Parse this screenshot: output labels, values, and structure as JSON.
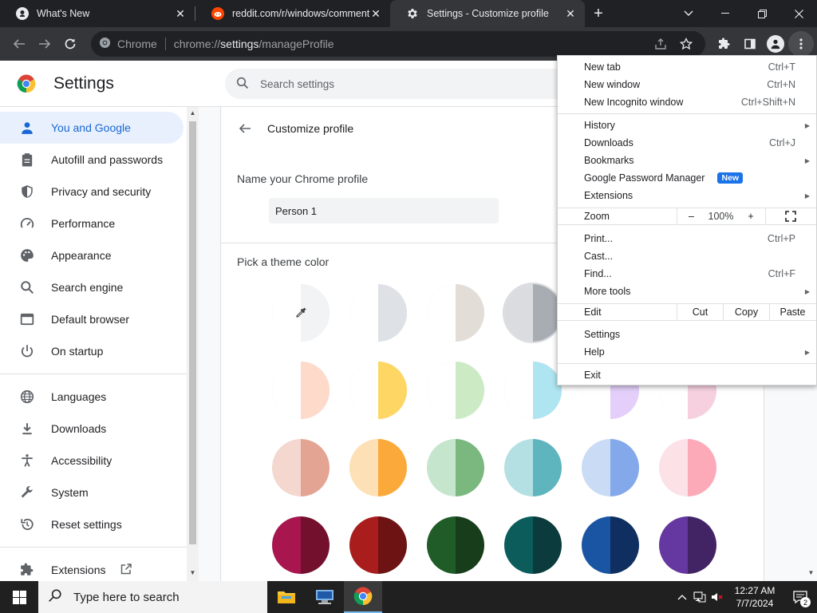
{
  "tabs": [
    {
      "title": "What's New",
      "icon": "github-icon"
    },
    {
      "title": "reddit.com/r/windows/comments",
      "icon": "reddit-icon"
    },
    {
      "title": "Settings - Customize profile",
      "icon": "gear-icon"
    }
  ],
  "omnibox": {
    "site": "Chrome",
    "url_scheme": "chrome://",
    "url_host": "settings",
    "url_path": "/manageProfile"
  },
  "settings": {
    "title": "Settings",
    "search_placeholder": "Search settings",
    "nav": [
      {
        "label": "You and Google",
        "icon": "person-icon"
      },
      {
        "label": "Autofill and passwords",
        "icon": "clipboard-icon"
      },
      {
        "label": "Privacy and security",
        "icon": "shield-icon"
      },
      {
        "label": "Performance",
        "icon": "gauge-icon"
      },
      {
        "label": "Appearance",
        "icon": "palette-icon"
      },
      {
        "label": "Search engine",
        "icon": "search-icon"
      },
      {
        "label": "Default browser",
        "icon": "browser-icon"
      },
      {
        "label": "On startup",
        "icon": "power-icon"
      },
      {
        "label": "Languages",
        "icon": "globe-icon"
      },
      {
        "label": "Downloads",
        "icon": "download-icon"
      },
      {
        "label": "Accessibility",
        "icon": "accessibility-icon"
      },
      {
        "label": "System",
        "icon": "wrench-icon"
      },
      {
        "label": "Reset settings",
        "icon": "reset-icon"
      },
      {
        "label": "Extensions",
        "icon": "puzzle-icon"
      }
    ]
  },
  "profile": {
    "heading": "Customize profile",
    "name_label": "Name your Chrome profile",
    "name_value": "Person 1",
    "theme_label": "Pick a theme color",
    "colors": {
      "row1": [
        [
          "#f1f3f4",
          "#f1f3f4"
        ],
        [
          "#ffffff",
          "#dee1e6"
        ],
        [
          "#ffffff",
          "#e3ddd8"
        ],
        [
          "#dadce0",
          "#a8adb3"
        ]
      ],
      "row2": [
        [
          "#ffffff",
          "#fddac9"
        ],
        [
          "#ffffff",
          "#fdd663"
        ],
        [
          "#ffffff",
          "#ccebc5"
        ],
        [
          "#ffffff",
          "#aee5f0"
        ],
        [
          "#ffffff",
          "#e3cff9"
        ],
        [
          "#ffffff",
          "#f6d0de"
        ]
      ],
      "row3": [
        [
          "#f4d7cf",
          "#e3a493"
        ],
        [
          "#fde0b5",
          "#fba93b"
        ],
        [
          "#c6e5cd",
          "#7ab87f"
        ],
        [
          "#b4e0e3",
          "#5eb5bd"
        ],
        [
          "#c9dbf5",
          "#84a9ea"
        ],
        [
          "#fce1e6",
          "#fcaab8"
        ]
      ],
      "row4": [
        [
          "#a8154f",
          "#72102d"
        ],
        [
          "#a91d1d",
          "#6e1313"
        ],
        [
          "#205c28",
          "#173d1b"
        ],
        [
          "#0c5c5c",
          "#0b3b3d"
        ],
        [
          "#1a55a3",
          "#0f2f61"
        ],
        [
          "#6438a0",
          "#422464"
        ]
      ]
    }
  },
  "menu": {
    "new_tab": {
      "label": "New tab",
      "shortcut": "Ctrl+T"
    },
    "new_window": {
      "label": "New window",
      "shortcut": "Ctrl+N"
    },
    "incognito": {
      "label": "New Incognito window",
      "shortcut": "Ctrl+Shift+N"
    },
    "history": {
      "label": "History"
    },
    "downloads": {
      "label": "Downloads",
      "shortcut": "Ctrl+J"
    },
    "bookmarks": {
      "label": "Bookmarks"
    },
    "password_manager": {
      "label": "Google Password Manager",
      "badge": "New"
    },
    "extensions": {
      "label": "Extensions"
    },
    "zoom": {
      "label": "Zoom",
      "minus": "–",
      "value": "100%",
      "plus": "+"
    },
    "print": {
      "label": "Print...",
      "shortcut": "Ctrl+P"
    },
    "cast": {
      "label": "Cast..."
    },
    "find": {
      "label": "Find...",
      "shortcut": "Ctrl+F"
    },
    "more_tools": {
      "label": "More tools"
    },
    "edit": {
      "label": "Edit",
      "cut": "Cut",
      "copy": "Copy",
      "paste": "Paste"
    },
    "settings": {
      "label": "Settings"
    },
    "help": {
      "label": "Help"
    },
    "exit": {
      "label": "Exit"
    }
  },
  "taskbar": {
    "search_placeholder": "Type here to search",
    "time": "12:27 AM",
    "date": "7/7/2024",
    "notification_count": "2"
  }
}
